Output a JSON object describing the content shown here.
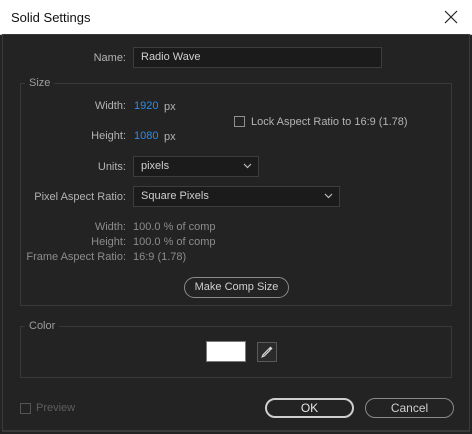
{
  "window": {
    "title": "Solid Settings",
    "close_icon": "close-icon"
  },
  "name": {
    "label": "Name:",
    "value": "Radio Wave"
  },
  "size": {
    "group_label": "Size",
    "width_label": "Width:",
    "width_value": "1920",
    "width_unit": "px",
    "height_label": "Height:",
    "height_value": "1080",
    "height_unit": "px",
    "lock_label": "Lock Aspect Ratio to 16:9 (1.78)",
    "lock_checked": false,
    "units_label": "Units:",
    "units_value": "pixels",
    "par_label": "Pixel Aspect Ratio:",
    "par_value": "Square Pixels",
    "info": {
      "width_label": "Width:",
      "width_value": "100.0 % of comp",
      "height_label": "Height:",
      "height_value": "100.0 % of comp",
      "far_label": "Frame Aspect Ratio:",
      "far_value": "16:9 (1.78)"
    },
    "make_comp_size": "Make Comp Size"
  },
  "color": {
    "group_label": "Color",
    "swatch_color": "#ffffff",
    "eyedropper_icon": "eyedropper-icon"
  },
  "footer": {
    "preview_label": "Preview",
    "preview_checked": false,
    "ok_label": "OK",
    "cancel_label": "Cancel"
  },
  "theme": {
    "accent_blue": "#2d8ceb",
    "background": "#232323"
  }
}
